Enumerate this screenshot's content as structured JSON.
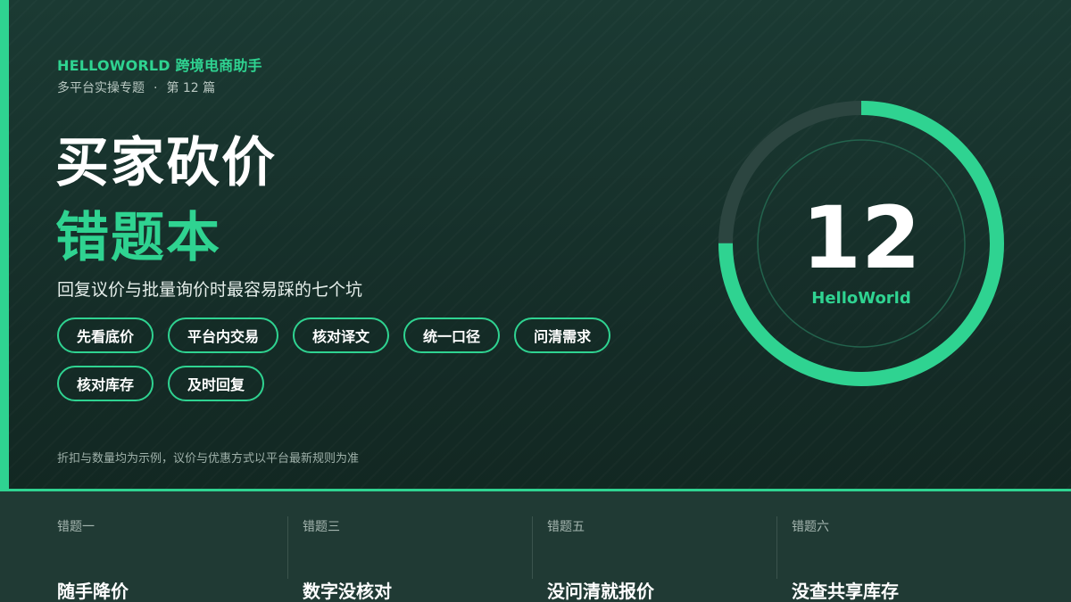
{
  "header": {
    "brand": "HELLOWORLD 跨境电商助手",
    "series": "多平台实操专题",
    "separator": "·",
    "issue": "第 12 篇"
  },
  "title": {
    "line1": "买家砍价",
    "line2": "错题本"
  },
  "description": "回复议价与批量询价时最容易踩的七个坑",
  "tags": [
    "先看底价",
    "平台内交易",
    "核对译文",
    "统一口径",
    "问清需求",
    "核对库存",
    "及时回复"
  ],
  "note": "折扣与数量均为示例，议价与优惠方式以平台最新规则为准",
  "ring": {
    "number": "12",
    "label": "HelloWorld",
    "progress": 0.75
  },
  "mistakes": [
    {
      "label": "错题一",
      "value": "随手降价"
    },
    {
      "label": "错题三",
      "value": "数字没核对"
    },
    {
      "label": "错题五",
      "value": "没问清就报价"
    },
    {
      "label": "错题六",
      "value": "没查共享库存"
    }
  ],
  "colors": {
    "accent": "#2fd391",
    "background": "#142b26",
    "ring_track": "#2c4540",
    "inner_ring": "#23634d",
    "bottom_band": "#203a34"
  }
}
